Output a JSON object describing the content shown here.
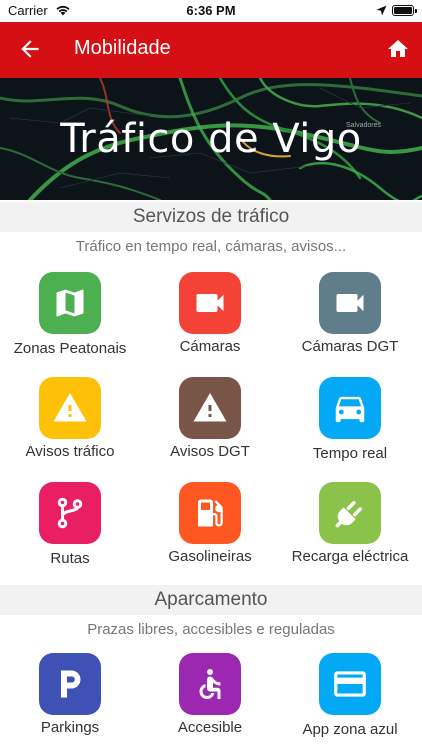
{
  "status_bar": {
    "carrier": "Carrier",
    "time": "6:36 PM"
  },
  "app_bar": {
    "title": "Mobilidade"
  },
  "hero": {
    "title": "Tráfico de Vigo",
    "map_place": "Salvadores"
  },
  "sections": [
    {
      "title": "Servizos de tráfico",
      "subtitle": "Tráfico en tempo real, cámaras, avisos...",
      "tiles": [
        {
          "label": "Zonas Peatonais",
          "icon": "map-icon",
          "color": "#4caf50"
        },
        {
          "label": "Cámaras",
          "icon": "videocam-icon",
          "color": "#f44336"
        },
        {
          "label": "Cámaras DGT",
          "icon": "videocam-icon",
          "color": "#607d8b"
        },
        {
          "label": "Avisos tráfico",
          "icon": "warning-icon",
          "color": "#ffc107"
        },
        {
          "label": "Avisos DGT",
          "icon": "warning-icon",
          "color": "#795548"
        },
        {
          "label": "Tempo real",
          "icon": "car-icon",
          "color": "#03a9f4"
        },
        {
          "label": "Rutas",
          "icon": "route-icon",
          "color": "#e91e63"
        },
        {
          "label": "Gasolineiras",
          "icon": "gas-station-icon",
          "color": "#ff5722"
        },
        {
          "label": "Recarga eléctrica",
          "icon": "plug-icon",
          "color": "#8bc34a"
        }
      ]
    },
    {
      "title": "Aparcamento",
      "subtitle": "Prazas libres, accesibles e reguladas",
      "tiles": [
        {
          "label": "Parkings",
          "icon": "parking-icon",
          "color": "#3f51b5"
        },
        {
          "label": "Accesible",
          "icon": "accessible-icon",
          "color": "#9c27b0"
        },
        {
          "label": "App zona azul",
          "icon": "card-icon",
          "color": "#03a9f4"
        }
      ]
    }
  ]
}
